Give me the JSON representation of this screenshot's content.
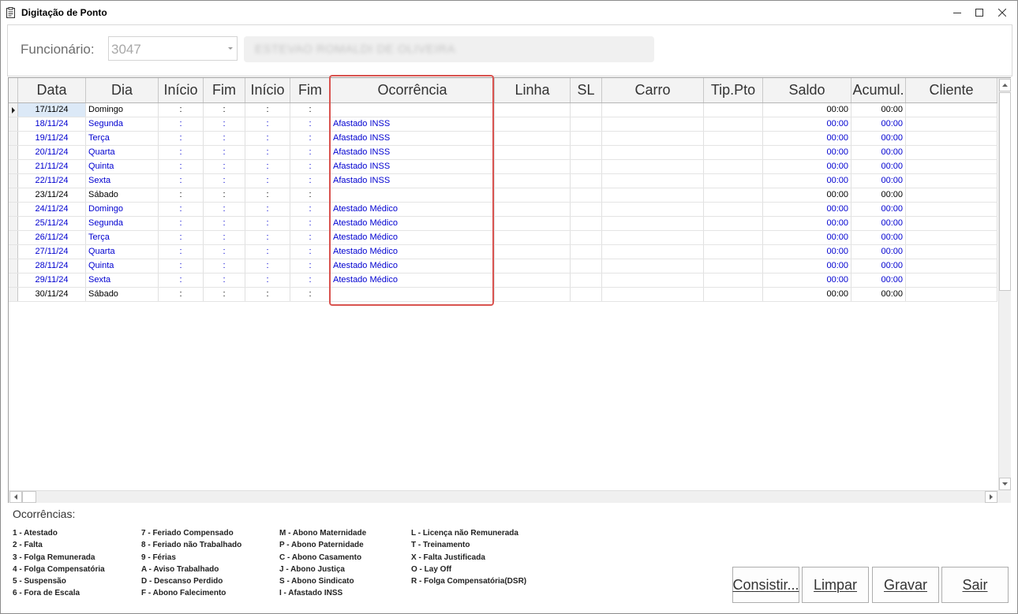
{
  "window": {
    "title": "Digitação de Ponto"
  },
  "header": {
    "funcionario_label": "Funcionário:",
    "funcionario_code": "3047",
    "funcionario_name": "ESTEVAO ROMALDI DE OLIVEIRA"
  },
  "grid": {
    "columns": [
      "Data",
      "Dia",
      "Início",
      "Fim",
      "Início",
      "Fim",
      "Ocorrência",
      "Linha",
      "SL",
      "Carro",
      "Tip.Pto",
      "Saldo",
      "Acumul.",
      "Cliente"
    ],
    "rows": [
      {
        "data": "17/11/24",
        "dia": "Domingo",
        "inicio1": ":",
        "fim1": ":",
        "inicio2": ":",
        "fim2": ":",
        "ocorrencia": "",
        "saldo": "00:00",
        "acumul": "00:00",
        "color": "#000000",
        "current": true
      },
      {
        "data": "18/11/24",
        "dia": "Segunda",
        "inicio1": ":",
        "fim1": ":",
        "inicio2": ":",
        "fim2": ":",
        "ocorrencia": "Afastado INSS",
        "saldo": "00:00",
        "acumul": "00:00",
        "color": "#0000d0"
      },
      {
        "data": "19/11/24",
        "dia": "Terça",
        "inicio1": ":",
        "fim1": ":",
        "inicio2": ":",
        "fim2": ":",
        "ocorrencia": "Afastado INSS",
        "saldo": "00:00",
        "acumul": "00:00",
        "color": "#0000d0"
      },
      {
        "data": "20/11/24",
        "dia": "Quarta",
        "inicio1": ":",
        "fim1": ":",
        "inicio2": ":",
        "fim2": ":",
        "ocorrencia": "Afastado INSS",
        "saldo": "00:00",
        "acumul": "00:00",
        "color": "#0000d0"
      },
      {
        "data": "21/11/24",
        "dia": "Quinta",
        "inicio1": ":",
        "fim1": ":",
        "inicio2": ":",
        "fim2": ":",
        "ocorrencia": "Afastado INSS",
        "saldo": "00:00",
        "acumul": "00:00",
        "color": "#0000d0"
      },
      {
        "data": "22/11/24",
        "dia": "Sexta",
        "inicio1": ":",
        "fim1": ":",
        "inicio2": ":",
        "fim2": ":",
        "ocorrencia": "Afastado INSS",
        "saldo": "00:00",
        "acumul": "00:00",
        "color": "#0000d0"
      },
      {
        "data": "23/11/24",
        "dia": "Sábado",
        "inicio1": ":",
        "fim1": ":",
        "inicio2": ":",
        "fim2": ":",
        "ocorrencia": "",
        "saldo": "00:00",
        "acumul": "00:00",
        "color": "#000000"
      },
      {
        "data": "24/11/24",
        "dia": "Domingo",
        "inicio1": ":",
        "fim1": ":",
        "inicio2": ":",
        "fim2": ":",
        "ocorrencia": "Atestado Médico",
        "saldo": "00:00",
        "acumul": "00:00",
        "color": "#0000d0"
      },
      {
        "data": "25/11/24",
        "dia": "Segunda",
        "inicio1": ":",
        "fim1": ":",
        "inicio2": ":",
        "fim2": ":",
        "ocorrencia": "Atestado Médico",
        "saldo": "00:00",
        "acumul": "00:00",
        "color": "#0000d0"
      },
      {
        "data": "26/11/24",
        "dia": "Terça",
        "inicio1": ":",
        "fim1": ":",
        "inicio2": ":",
        "fim2": ":",
        "ocorrencia": "Atestado Médico",
        "saldo": "00:00",
        "acumul": "00:00",
        "color": "#0000d0"
      },
      {
        "data": "27/11/24",
        "dia": "Quarta",
        "inicio1": ":",
        "fim1": ":",
        "inicio2": ":",
        "fim2": ":",
        "ocorrencia": "Atestado Médico",
        "saldo": "00:00",
        "acumul": "00:00",
        "color": "#0000d0"
      },
      {
        "data": "28/11/24",
        "dia": "Quinta",
        "inicio1": ":",
        "fim1": ":",
        "inicio2": ":",
        "fim2": ":",
        "ocorrencia": "Atestado Médico",
        "saldo": "00:00",
        "acumul": "00:00",
        "color": "#0000d0"
      },
      {
        "data": "29/11/24",
        "dia": "Sexta",
        "inicio1": ":",
        "fim1": ":",
        "inicio2": ":",
        "fim2": ":",
        "ocorrencia": "Atestado Médico",
        "saldo": "00:00",
        "acumul": "00:00",
        "color": "#0000d0"
      },
      {
        "data": "30/11/24",
        "dia": "Sábado",
        "inicio1": ":",
        "fim1": ":",
        "inicio2": ":",
        "fim2": ":",
        "ocorrencia": "",
        "saldo": "00:00",
        "acumul": "00:00",
        "color": "#000000"
      }
    ]
  },
  "legend": {
    "title": "Ocorrências:",
    "col1": [
      "1 - Atestado",
      "2 - Falta",
      "3 - Folga Remunerada",
      "4 - Folga Compensatória",
      "5 - Suspensão",
      "6 - Fora de Escala"
    ],
    "col2": [
      "7 - Feriado Compensado",
      "8 - Feriado não Trabalhado",
      "9 - Férias",
      "A - Aviso Trabalhado",
      "D - Descanso Perdido",
      "F - Abono Falecimento"
    ],
    "col3": [
      "M - Abono Maternidade",
      "P - Abono Paternidade",
      "C - Abono Casamento",
      "J - Abono Justiça",
      "S - Abono Sindicato",
      "I - Afastado INSS"
    ],
    "col4": [
      "L - Licença não Remunerada",
      "T - Treinamento",
      "X - Falta Justificada",
      "O - Lay Off",
      "R - Folga Compensatória(DSR)"
    ]
  },
  "buttons": {
    "consistir": "Consistir...",
    "limpar": "Limpar",
    "gravar": "Gravar",
    "sair": "Sair"
  },
  "colors": {
    "highlight_border": "#d9534f",
    "text_blue": "#0000d0"
  }
}
